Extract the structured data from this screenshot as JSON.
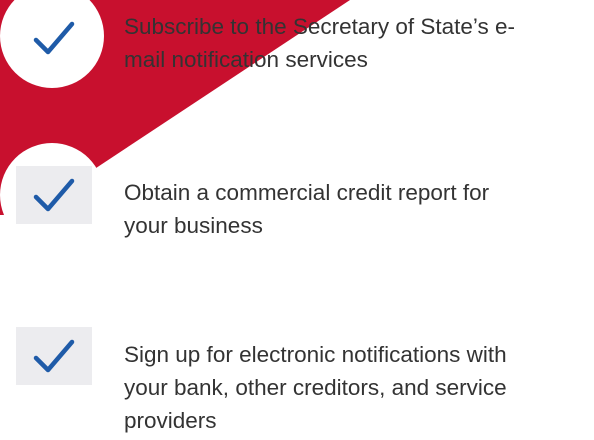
{
  "colors": {
    "accent_red": "#c8102e",
    "check_blue": "#1f5ba8",
    "tile_gray": "#ececef",
    "text": "#333333"
  },
  "checklist": [
    {
      "icon": "checkmark-icon",
      "lines": [
        "Subscribe to the Secretary of State’s e-",
        "mail notification services"
      ]
    },
    {
      "icon": "checkmark-icon",
      "lines": [
        "Obtain a commercial credit report for",
        "your business"
      ]
    },
    {
      "icon": "checkmark-icon",
      "lines": [
        "Sign up for electronic notifications with",
        "your bank, other creditors, and service",
        "providers"
      ]
    }
  ]
}
